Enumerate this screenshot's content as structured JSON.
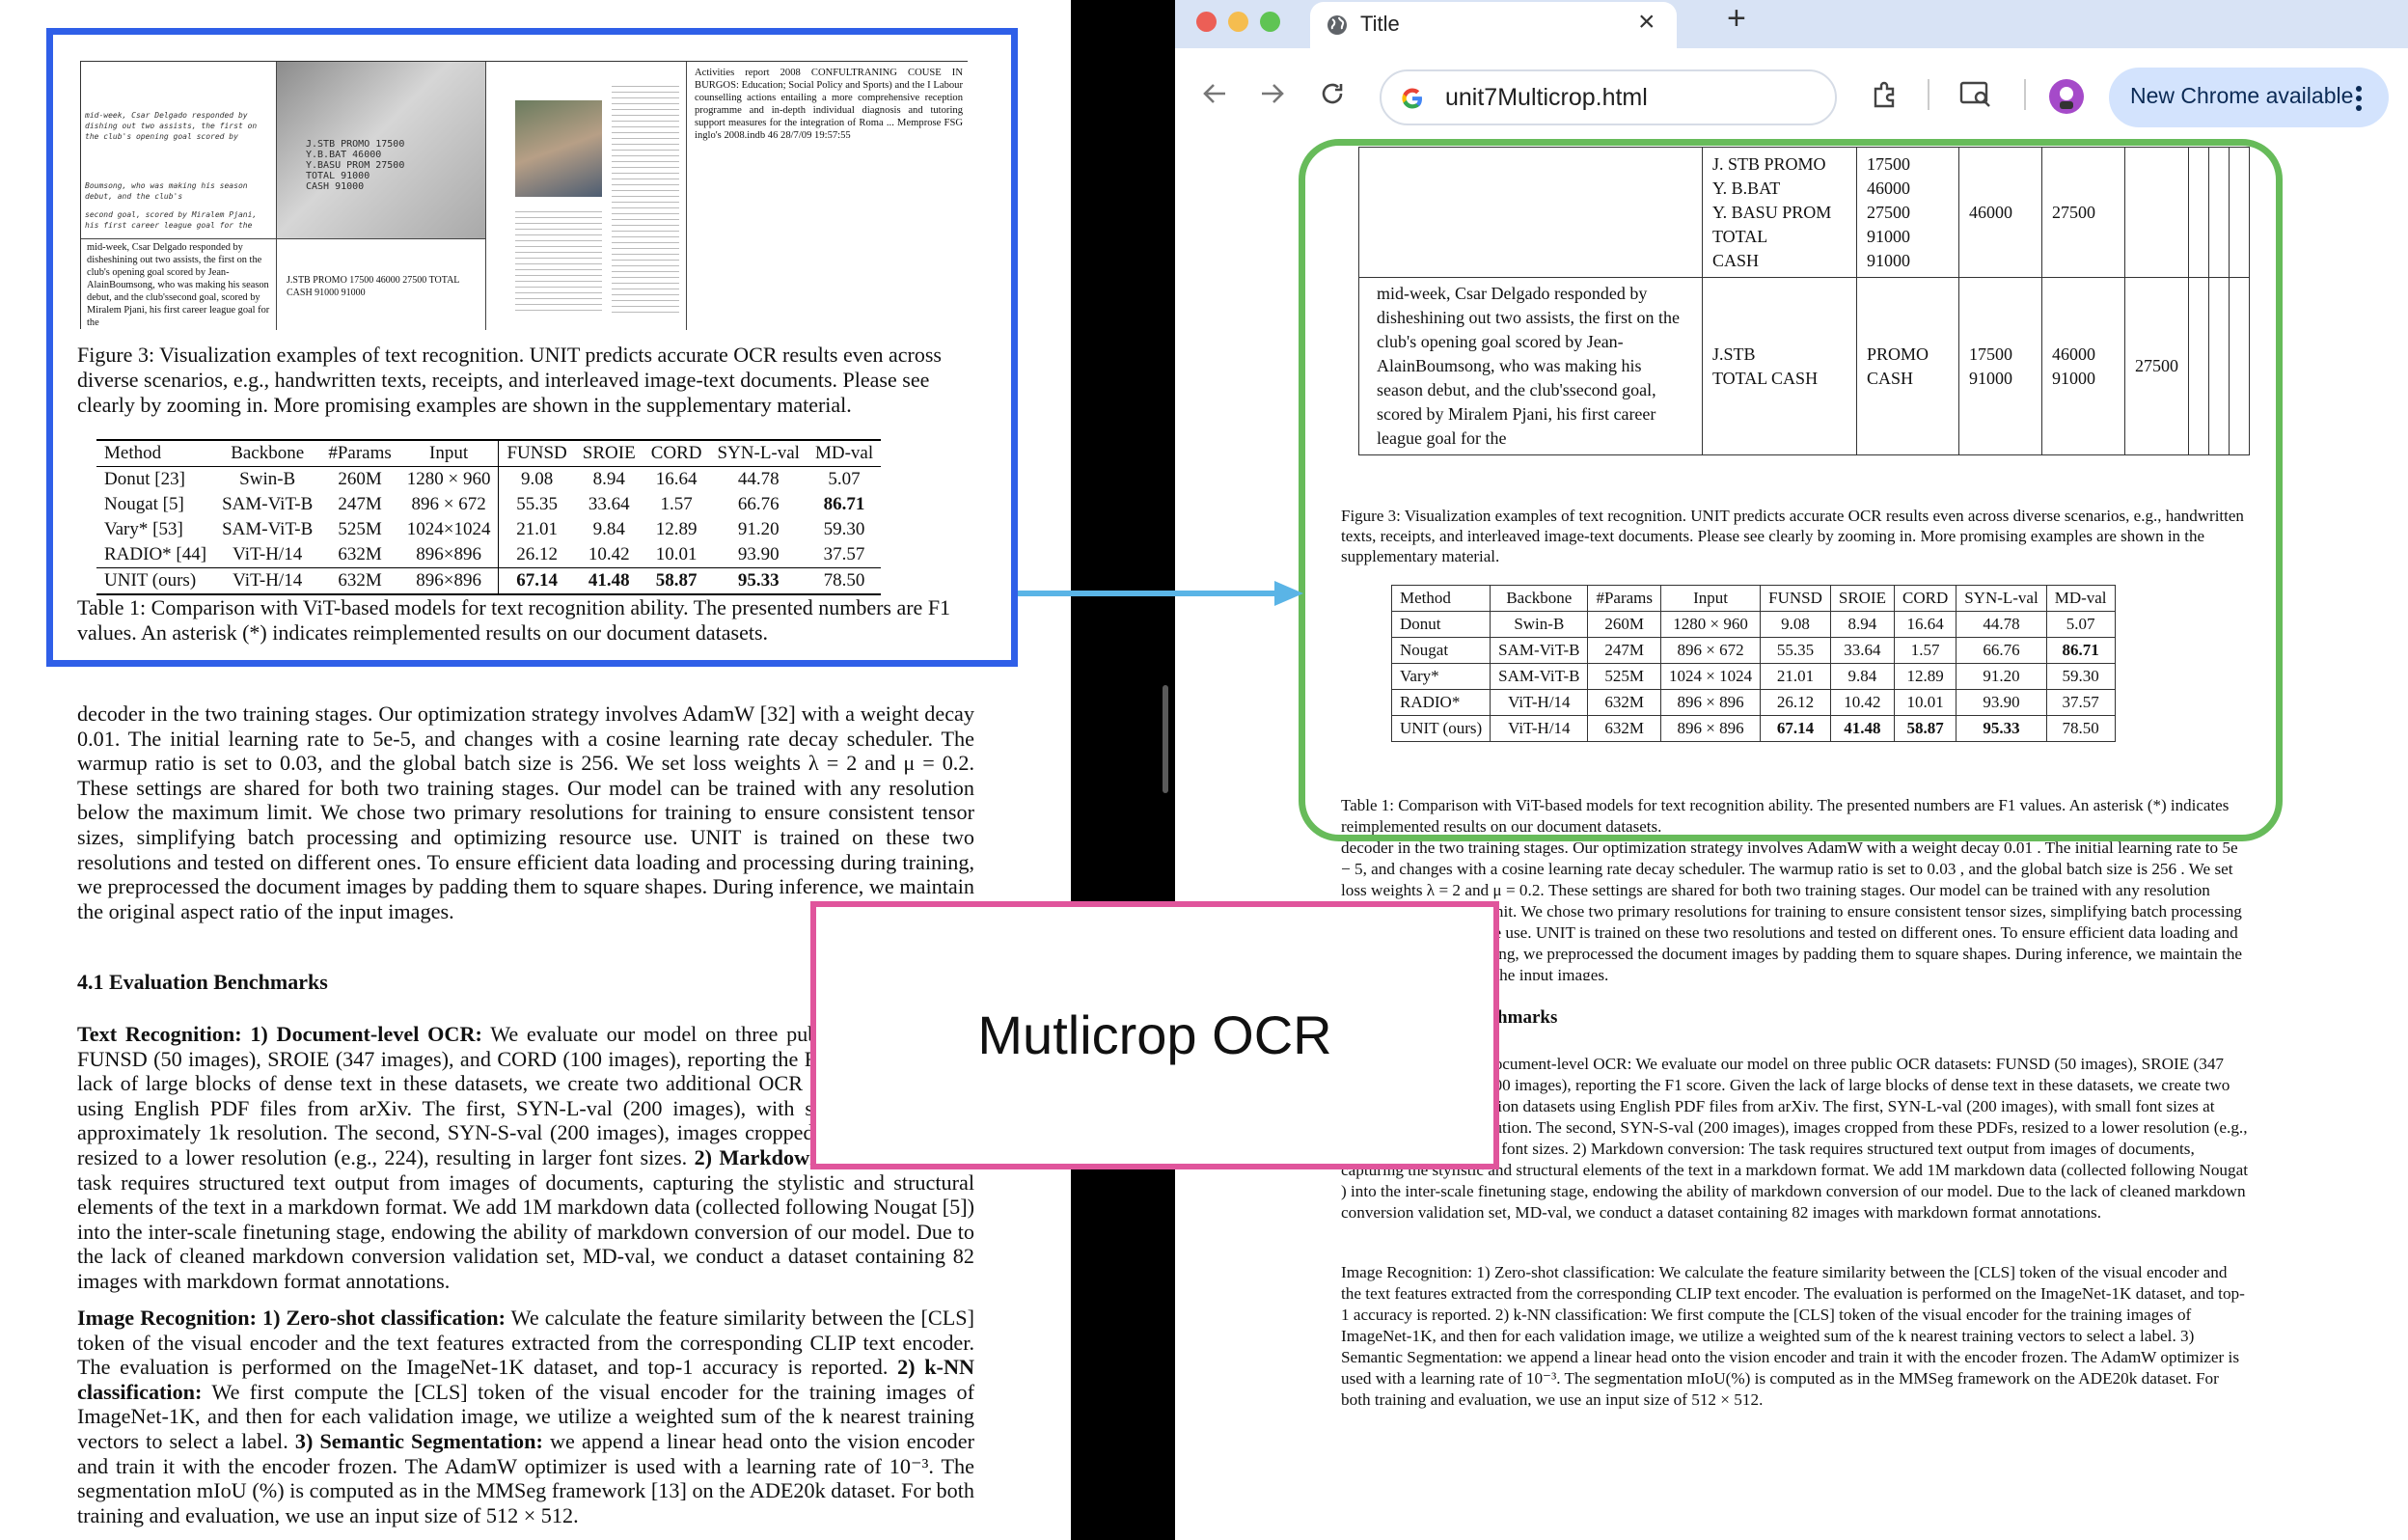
{
  "left_doc": {
    "figure_cells": {
      "handwriting": [
        "mid-week, Csar Delgado responded by dishing out two assists, the first on the club's opening goal scored by",
        "Boumsong, who was making his season debut, and the club's",
        "second goal, scored by Miralem Pjani, his first career league goal for the"
      ],
      "handwriting_ocr": "mid-week, Csar Delgado responded by disheshining out two assists, the first on the club's opening goal scored by Jean-AlainBoumsong, who was making his season debut, and the club'ssecond goal, scored by Miralem Pjani, his first career league goal for the",
      "receipt_lines": [
        "J.STB PROMO 17500",
        "Y.B.BAT 46000",
        "Y.BASU PROM 27500",
        "TOTAL 91000",
        "CASH 91000"
      ],
      "receipt_ocr": "J.STB PROMO 17500 46000 27500 TOTAL CASH 91000 91000",
      "report_text": "Activities report 2008 CONFULTRANING COUSE IN BURGOS: Education; Social Policy and Sports) and the I Labour counselling actions entailing a more comprehensive reception programme and in-depth individual diagnosis and tutoring support measures for the integration of Roma ... Memprose FSG inglo's 2008.indb 46 28/7/09 19:57:55"
    },
    "figure_caption": "Figure 3: Visualization examples of text recognition. UNIT predicts accurate OCR results even across diverse scenarios, e.g., handwritten texts, receipts, and interleaved image-text documents. Please see clearly by zooming in. More promising examples are shown in the supplementary material.",
    "table1": {
      "headers": [
        "Method",
        "Backbone",
        "#Params",
        "Input",
        "FUNSD",
        "SROIE",
        "CORD",
        "SYN-L-val",
        "MD-val"
      ],
      "rows": [
        [
          "Donut [23]",
          "Swin-B",
          "260M",
          "1280 × 960",
          "9.08",
          "8.94",
          "16.64",
          "44.78",
          "5.07"
        ],
        [
          "Nougat [5]",
          "SAM-ViT-B",
          "247M",
          "896 × 672",
          "55.35",
          "33.64",
          "1.57",
          "66.76",
          "86.71"
        ],
        [
          "Vary* [53]",
          "SAM-ViT-B",
          "525M",
          "1024×1024",
          "21.01",
          "9.84",
          "12.89",
          "91.20",
          "59.30"
        ],
        [
          "RADIO* [44]",
          "ViT-H/14",
          "632M",
          "896×896",
          "26.12",
          "10.42",
          "10.01",
          "93.90",
          "37.57"
        ],
        [
          "UNIT (ours)",
          "ViT-H/14",
          "632M",
          "896×896",
          "67.14",
          "41.48",
          "58.87",
          "95.33",
          "78.50"
        ]
      ]
    },
    "table1_caption": "Table 1: Comparison with ViT-based models for text recognition ability. The presented numbers are F1 values. An asterisk (*) indicates reimplemented results on our document datasets.",
    "para1": "decoder in the two training stages. Our optimization strategy involves AdamW [32] with a weight decay 0.01. The initial learning rate to 5e-5, and changes with a cosine learning rate decay scheduler. The warmup ratio is set to 0.03, and the global batch size is 256. We set loss weights λ = 2 and μ = 0.2. These settings are shared for both two training stages. Our model can be trained with any resolution below the maximum limit. We chose two primary resolutions for training to ensure consistent tensor sizes, simplifying batch processing and optimizing resource use. UNIT is trained on these two resolutions and tested on different ones. To ensure efficient data loading and processing during training, we preprocessed the document images by padding them to square shapes. During inference, we maintain the original aspect ratio of the input images.",
    "section_heading": "4.1 Evaluation Benchmarks",
    "text_rec_head": "Text Recognition: 1) Document-level OCR:",
    "text_rec_body": " We evaluate our model on three public OCR datasets: FUNSD (50 images), SROIE (347 images), and CORD (100 images), reporting the F1 score. Given the lack of large blocks of dense text in these datasets, we create two additional OCR evaluation datasets using English PDF files from arXiv. The first, SYN-L-val (200 images), with small font sizes at approximately 1k resolution. The second, SYN-S-val (200 images), images cropped from these PDFs, resized to a lower resolution (e.g., 224), resulting in larger font sizes.",
    "md_head": " 2) Markdown conversion:",
    "md_body": " The task requires structured text output from images of documents, capturing the stylistic and structural elements of the text in a markdown format. We add 1M markdown data (collected following Nougat [5]) into the inter-scale finetuning stage, endowing the ability of markdown conversion of our model. Due to the lack of cleaned markdown conversion validation set, MD-val, we conduct a dataset containing 82 images with markdown format annotations.",
    "img_head": "Image Recognition: 1) Zero-shot classification:",
    "img_body1": " We calculate the feature similarity between the [CLS] token of the visual encoder and the text features extracted from the corresponding CLIP text encoder. The evaluation is performed on the ImageNet-1K dataset, and top-1 accuracy is reported.",
    "knn_head": " 2) k-NN classification:",
    "knn_body": " We first compute the [CLS] token of the visual encoder for the training images of ImageNet-1K, and then for each validation image, we utilize a weighted sum of the k nearest training vectors to select a label.",
    "seg_head": " 3) Semantic Segmentation:",
    "seg_body": " we append a linear head onto the vision encoder and train it with the encoder frozen. The AdamW optimizer is used with a learning rate of 10⁻³. The segmentation mIoU (%) is computed as in the MMSeg framework [13] on the ADE20k dataset. For both training and evaluation, we use an input size of 512 × 512."
  },
  "browser": {
    "tab_title": "Title",
    "new_tab": "+",
    "close_tab": "×",
    "url": "unit7Multicrop.html",
    "update_label": "New Chrome available",
    "colors": {
      "tabbar": "#d8e3f5",
      "update_bg": "#d3e3fd"
    }
  },
  "right_doc": {
    "receipt_rows": [
      "J. STB PROMO",
      "Y. B.BAT",
      "Y. BASU PROM",
      "TOTAL",
      "CASH"
    ],
    "receipt_vals": [
      "17500",
      "46000",
      "27500",
      "91000",
      "91000"
    ],
    "receipt_extra": [
      "46000",
      "27500"
    ],
    "hw_text": "mid-week, Csar Delgado responded by disheshining out two assists, the first on the club's opening goal scored by Jean-AlainBoumsong, who was making his season debut, and the club'ssecond goal, scored by Miralem Pjani, his first career league goal for the",
    "hw_cells": [
      "J.STB\nTOTAL CASH",
      "PROMO\nCASH",
      "17500\n91000",
      "46000\n91000",
      "27500"
    ],
    "figure_caption": "Figure 3: Visualization examples of text recognition. UNIT predicts accurate OCR results even across diverse scenarios, e.g., handwritten texts, receipts, and interleaved image-text documents. Please see clearly by zooming in. More promising examples are shown in the supplementary material.",
    "table1": {
      "headers": [
        "Method",
        "Backbone",
        "#Params",
        "Input",
        "FUNSD",
        "SROIE",
        "CORD",
        "SYN-L-val",
        "MD-val"
      ],
      "rows": [
        [
          "Donut",
          "Swin-B",
          "260M",
          "1280 × 960",
          "9.08",
          "8.94",
          "16.64",
          "44.78",
          "5.07"
        ],
        [
          "Nougat",
          "SAM-ViT-B",
          "247M",
          "896 × 672",
          "55.35",
          "33.64",
          "1.57",
          "66.76",
          "86.71"
        ],
        [
          "Vary*",
          "SAM-ViT-B",
          "525M",
          "1024 × 1024",
          "21.01",
          "9.84",
          "12.89",
          "91.20",
          "59.30"
        ],
        [
          "RADIO*",
          "ViT-H/14",
          "632M",
          "896 × 896",
          "26.12",
          "10.42",
          "10.01",
          "93.90",
          "37.57"
        ],
        [
          "UNIT (ours)",
          "ViT-H/14",
          "632M",
          "896 × 896",
          "67.14",
          "41.48",
          "58.87",
          "95.33",
          "78.50"
        ]
      ]
    },
    "table1_caption": "Table 1: Comparison with ViT-based models for text recognition ability. The presented numbers are F1 values. An asterisk (*) indicates reimplemented results on our document datasets.",
    "para1": "decoder in the two training stages. Our optimization strategy involves AdamW with a weight decay 0.01 . The initial learning rate to 5e − 5, and changes with a cosine learning rate decay scheduler. The warmup ratio is set to 0.03 , and the global batch size is 256 . We set loss weights λ = 2 and μ = 0.2. These settings are shared for both two training stages. Our model can be trained with any resolution below the maximum limit. We chose two primary resolutions for training to ensure consistent tensor sizes, simplifying batch processing and optimizing resource use. UNIT is trained on these two resolutions and tested on different ones. To ensure efficient data loading and processing during training, we preprocessed the document images by padding them to square shapes. During inference, we maintain the original aspect ratio of the input images.",
    "section_heading": "4.1 Evaluation Benchmarks",
    "para2": "Text Recognition: 1) Document-level OCR: We evaluate our model on three public OCR datasets: FUNSD (50 images), SROIE (347 images), and CORD (100 images), reporting the F1 score. Given the lack of large blocks of dense text in these datasets, we create two additional OCR evaluation datasets using English PDF files from arXiv. The first, SYN-L-val (200 images), with small font sizes at approximately 1k resolution. The second, SYN-S-val (200 images), images cropped from these PDFs, resized to a lower resolution (e.g., 224), resulting in larger font sizes. 2) Markdown conversion: The task requires structured text output from images of documents, capturing the stylistic and structural elements of the text in a markdown format. We add 1M markdown data (collected following Nougat ) into the inter-scale finetuning stage, endowing the ability of markdown conversion of our model. Due to the lack of cleaned markdown conversion validation set, MD-val, we conduct a dataset containing 82 images with markdown format annotations.",
    "para3": "Image Recognition: 1) Zero-shot classification: We calculate the feature similarity between the [CLS] token of the visual encoder and the text features extracted from the corresponding CLIP text encoder. The evaluation is performed on the ImageNet-1K dataset, and top-1 accuracy is reported. 2) k-NN classification: We first compute the [CLS] token of the visual encoder for the training images of ImageNet-1K, and then for each validation image, we utilize a weighted sum of the k nearest training vectors to select a label. 3) Semantic Segmentation: we append a linear head onto the vision encoder and train it with the encoder frozen. The AdamW optimizer is used with a learning rate of 10⁻³. The segmentation mIoU(%) is computed as in the MMSeg framework on the ADE20k dataset. For both training and evaluation, we use an input size of 512 × 512."
  },
  "overlay": {
    "label": "Mutlicrop OCR",
    "colors": {
      "pink": "#e0559c",
      "blue": "#2f5fe8",
      "green": "#67bb5a",
      "arrow": "#5ab4e6"
    }
  }
}
